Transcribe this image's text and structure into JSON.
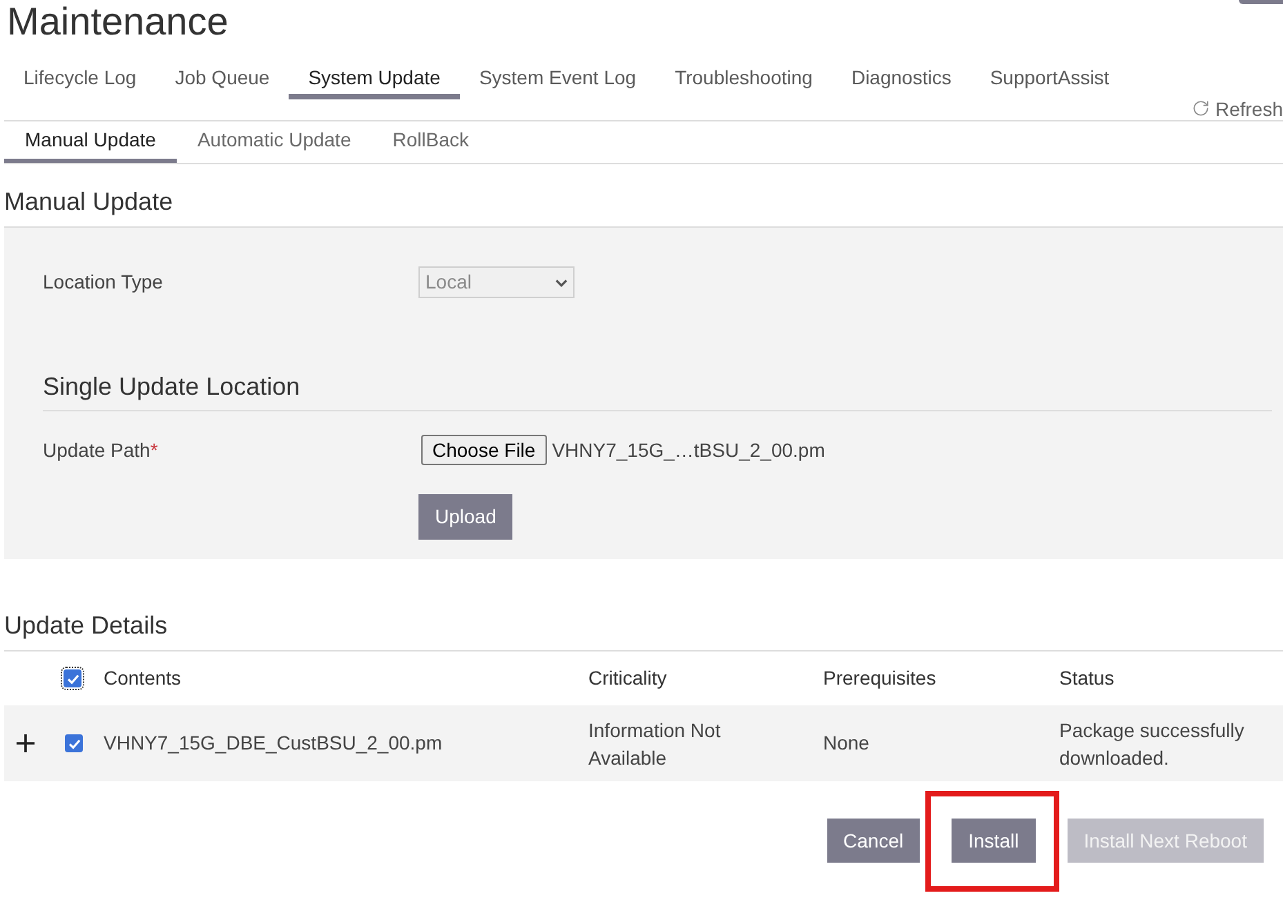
{
  "title": "Maintenance",
  "tabs": [
    {
      "label": "Lifecycle Log",
      "selected": false
    },
    {
      "label": "Job Queue",
      "selected": false
    },
    {
      "label": "System Update",
      "selected": true
    },
    {
      "label": "System Event Log",
      "selected": false
    },
    {
      "label": "Troubleshooting",
      "selected": false
    },
    {
      "label": "Diagnostics",
      "selected": false
    },
    {
      "label": "SupportAssist",
      "selected": false
    }
  ],
  "refresh": {
    "label": "Refresh"
  },
  "subtabs": [
    {
      "label": "Manual Update",
      "selected": true
    },
    {
      "label": "Automatic Update",
      "selected": false
    },
    {
      "label": "RollBack",
      "selected": false
    }
  ],
  "manual_update": {
    "heading": "Manual Update",
    "location_type": {
      "label": "Location Type",
      "value": "Local",
      "disabled": true
    },
    "single_update_location": {
      "heading": "Single Update Location",
      "update_path": {
        "label": "Update Path",
        "required_mark": "*",
        "button": "Choose File",
        "file_name": "VHNY7_15G_…tBSU_2_00.pm"
      },
      "upload_button": "Upload"
    }
  },
  "update_details": {
    "heading": "Update Details",
    "select_all": {
      "checked": true,
      "focused": true
    },
    "columns": [
      "Contents",
      "Criticality",
      "Prerequisites",
      "Status"
    ],
    "rows": [
      {
        "expanded": false,
        "checked": true,
        "contents": "VHNY7_15G_DBE_CustBSU_2_00.pm",
        "criticality": "Information Not Available",
        "prerequisites": "None",
        "status": "Package successfully downloaded."
      }
    ]
  },
  "actions": [
    {
      "label": "Cancel",
      "disabled": false,
      "highlighted": false
    },
    {
      "label": "Install",
      "disabled": false,
      "highlighted": true
    },
    {
      "label": "Install Next Reboot",
      "disabled": true,
      "highlighted": false
    }
  ]
}
